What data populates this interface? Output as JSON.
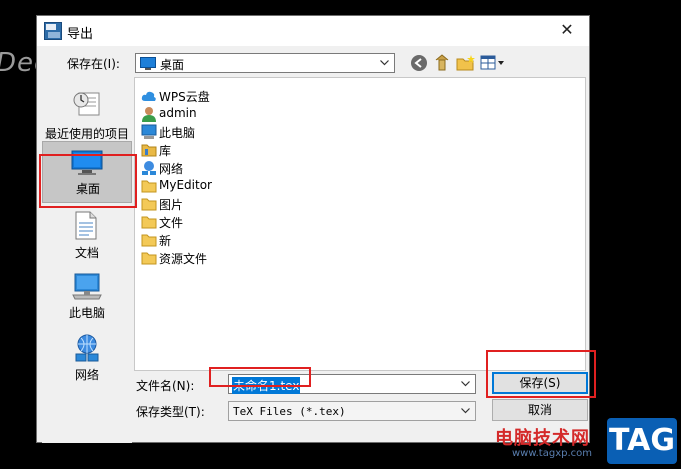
{
  "background": {
    "partial_text": "Dec"
  },
  "window": {
    "title": "导出",
    "close_glyph": "✕"
  },
  "location": {
    "label": "保存在(I):",
    "value": "桌面"
  },
  "places": [
    {
      "label": "最近使用的项目",
      "icon": "recent-items-icon"
    },
    {
      "label": "桌面",
      "icon": "desktop-icon",
      "selected": true
    },
    {
      "label": "文档",
      "icon": "documents-icon"
    },
    {
      "label": "此电脑",
      "icon": "this-pc-icon"
    },
    {
      "label": "网络",
      "icon": "network-icon"
    }
  ],
  "files": [
    {
      "name": "WPS云盘",
      "icon": "cloud-icon"
    },
    {
      "name": "admin",
      "icon": "user-icon"
    },
    {
      "name": "此电脑",
      "icon": "computer-icon"
    },
    {
      "name": "库",
      "icon": "library-folder-icon"
    },
    {
      "name": "网络",
      "icon": "network-icon"
    },
    {
      "name": "MyEditor",
      "icon": "folder-icon"
    },
    {
      "name": "图片",
      "icon": "folder-icon"
    },
    {
      "name": "文件",
      "icon": "folder-icon"
    },
    {
      "name": "新",
      "icon": "folder-icon"
    },
    {
      "name": "资源文件",
      "icon": "folder-icon"
    }
  ],
  "filename": {
    "label": "文件名(N):",
    "value": "未命名1.tex"
  },
  "filetype": {
    "label": "保存类型(T):",
    "value": "TeX Files (*.tex)"
  },
  "buttons": {
    "save": "保存(S)",
    "cancel": "取消"
  },
  "highlight_color": "#e02020",
  "watermark": {
    "site_name": "电脑技术网",
    "url": "www.tagxp.com",
    "tag": "TAG"
  }
}
